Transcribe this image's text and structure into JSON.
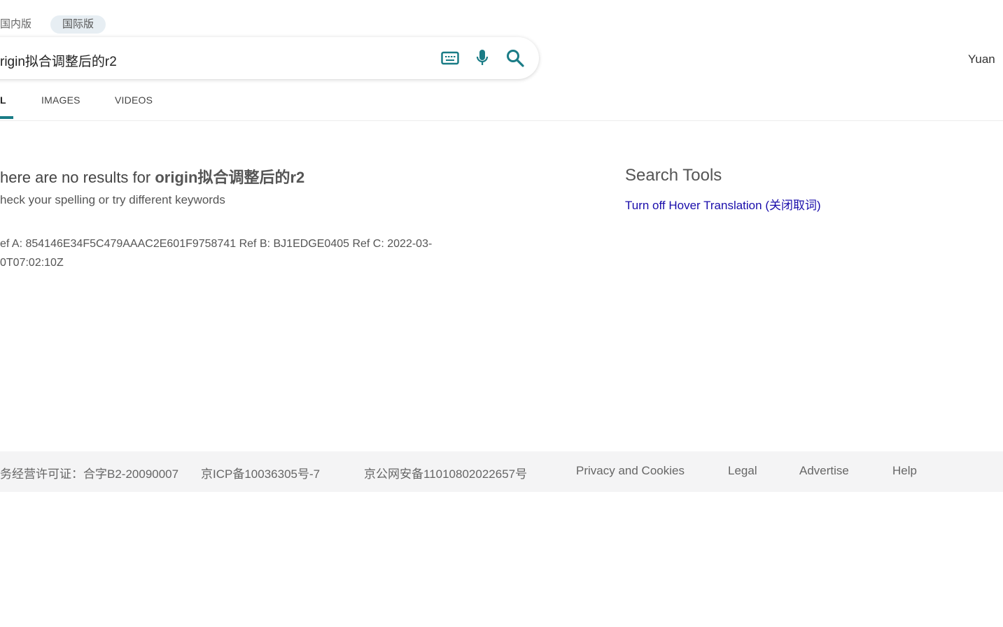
{
  "header": {
    "scopes": [
      {
        "label": "国内版",
        "active": false
      },
      {
        "label": "国际版",
        "active": true
      }
    ],
    "search": {
      "value": "rigin拟合调整后的r2"
    },
    "icons": [
      "keyboard-icon",
      "microphone-icon",
      "search-icon"
    ],
    "user_name": "Yuan",
    "accent_color": "#1a7c86"
  },
  "tabs": [
    {
      "label": "L",
      "active": true
    },
    {
      "label": "IMAGES",
      "active": false
    },
    {
      "label": "VIDEOS",
      "active": false
    }
  ],
  "results": {
    "no_results_prefix": "here are no results for ",
    "no_results_query": "origin拟合调整后的r2",
    "hint": "heck your spelling or try different keywords",
    "ref_line1": "ef A: 854146E34F5C479AAAC2E601F9758741 Ref B: BJ1EDGE0405 Ref C: 2022-03-",
    "ref_line2": "0T07:02:10Z"
  },
  "sidebar": {
    "title": "Search Tools",
    "link": "Turn off Hover Translation (关闭取词)"
  },
  "footer": {
    "links": [
      "务经营许可证：合字B2-20090007",
      "京ICP备10036305号-7",
      "京公网安备11010802022657号",
      "Privacy and Cookies",
      "Legal",
      "Advertise",
      "Help"
    ]
  }
}
